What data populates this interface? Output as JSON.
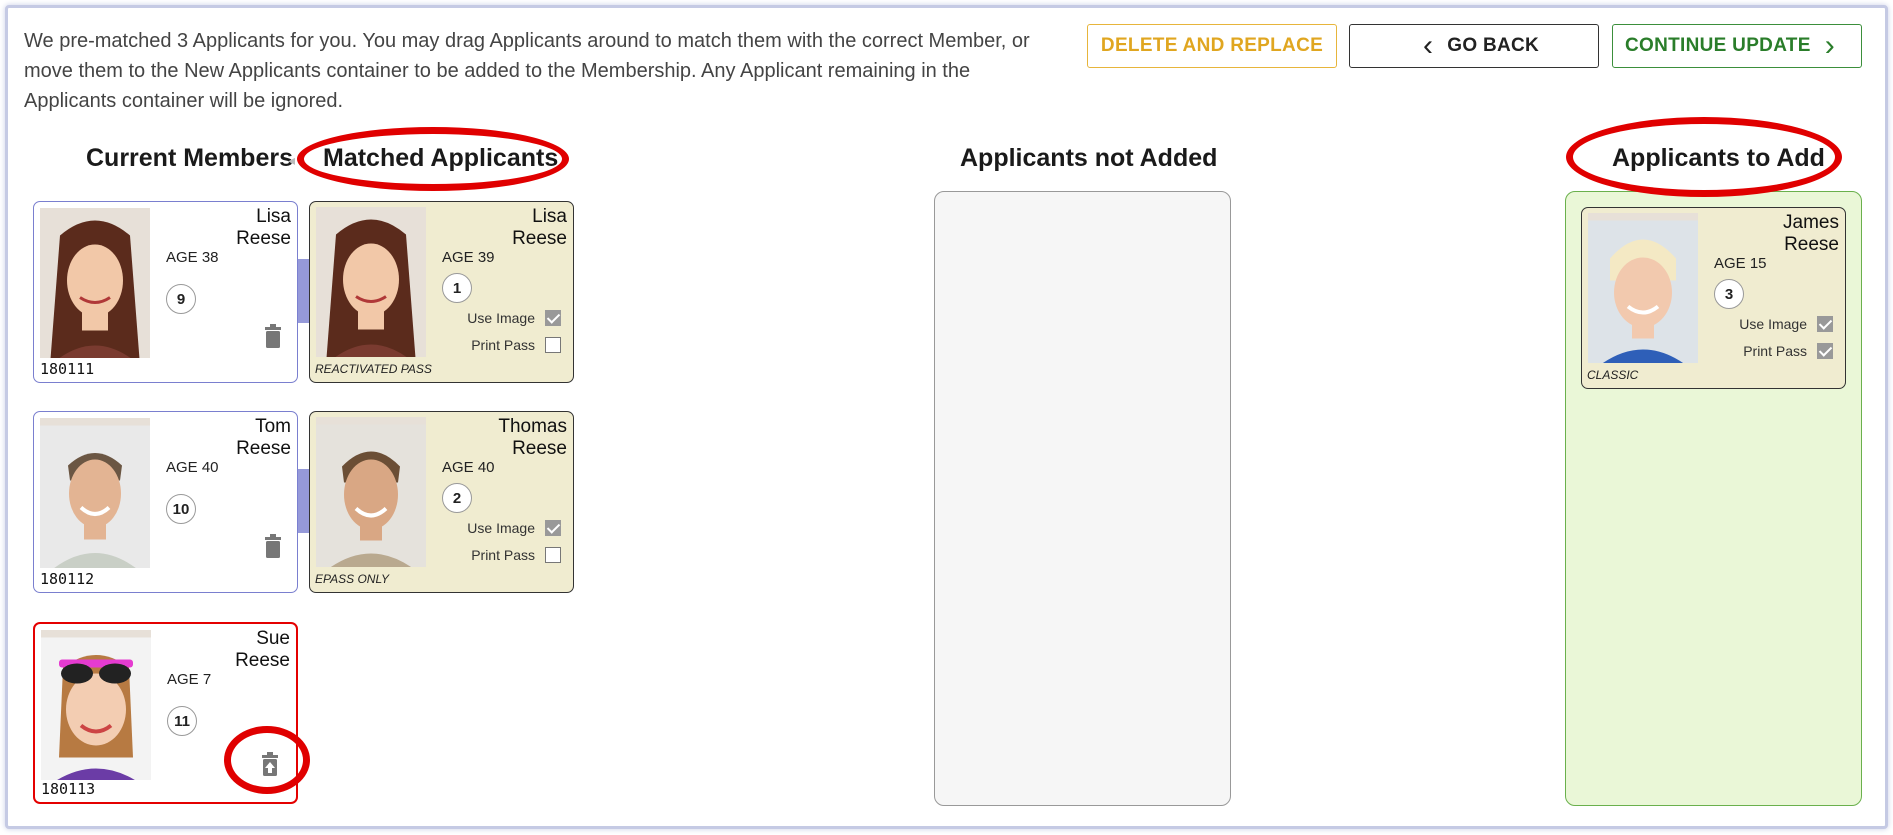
{
  "instructions": "We pre-matched 3 Applicants for you. You may drag Applicants around to match them with the correct Member, or move them to the New Applicants container to be added to the Membership. Any Applicant remaining in the Applicants container will be ignored.",
  "buttons": {
    "delete_replace": "DELETE AND REPLACE",
    "go_back": "GO BACK",
    "continue_update": "CONTINUE UPDATE"
  },
  "headings": {
    "current_members": "Current Members",
    "matched_applicants": "Matched Applicants",
    "applicants_not_added": "Applicants not Added",
    "applicants_to_add": "Applicants to Add"
  },
  "labels": {
    "use_image": "Use Image",
    "print_pass": "Print Pass"
  },
  "members": [
    {
      "first": "Lisa",
      "last": "Reese",
      "age": "AGE 38",
      "num": "9",
      "id": "180111"
    },
    {
      "first": "Tom",
      "last": "Reese",
      "age": "AGE 40",
      "num": "10",
      "id": "180112"
    },
    {
      "first": "Sue",
      "last": "Reese",
      "age": "AGE 7",
      "num": "11",
      "id": "180113"
    }
  ],
  "matched": [
    {
      "first": "Lisa",
      "last": "Reese",
      "age": "AGE 39",
      "num": "1",
      "use_image": true,
      "print_pass": false,
      "pass": "REACTIVATED PASS"
    },
    {
      "first": "Thomas",
      "last": "Reese",
      "age": "AGE 40",
      "num": "2",
      "use_image": true,
      "print_pass": false,
      "pass": "EPASS ONLY"
    }
  ],
  "to_add": [
    {
      "first": "James",
      "last": "Reese",
      "age": "AGE 15",
      "num": "3",
      "use_image": true,
      "print_pass": true,
      "pass": "CLASSIC"
    }
  ],
  "colors": {
    "member_border": "#7a7fcf",
    "removed_border": "#e40000",
    "applicant_bg": "#f0ecd0",
    "to_add_bg": "#eaf7d7",
    "highlight_ring": "#e00000"
  }
}
